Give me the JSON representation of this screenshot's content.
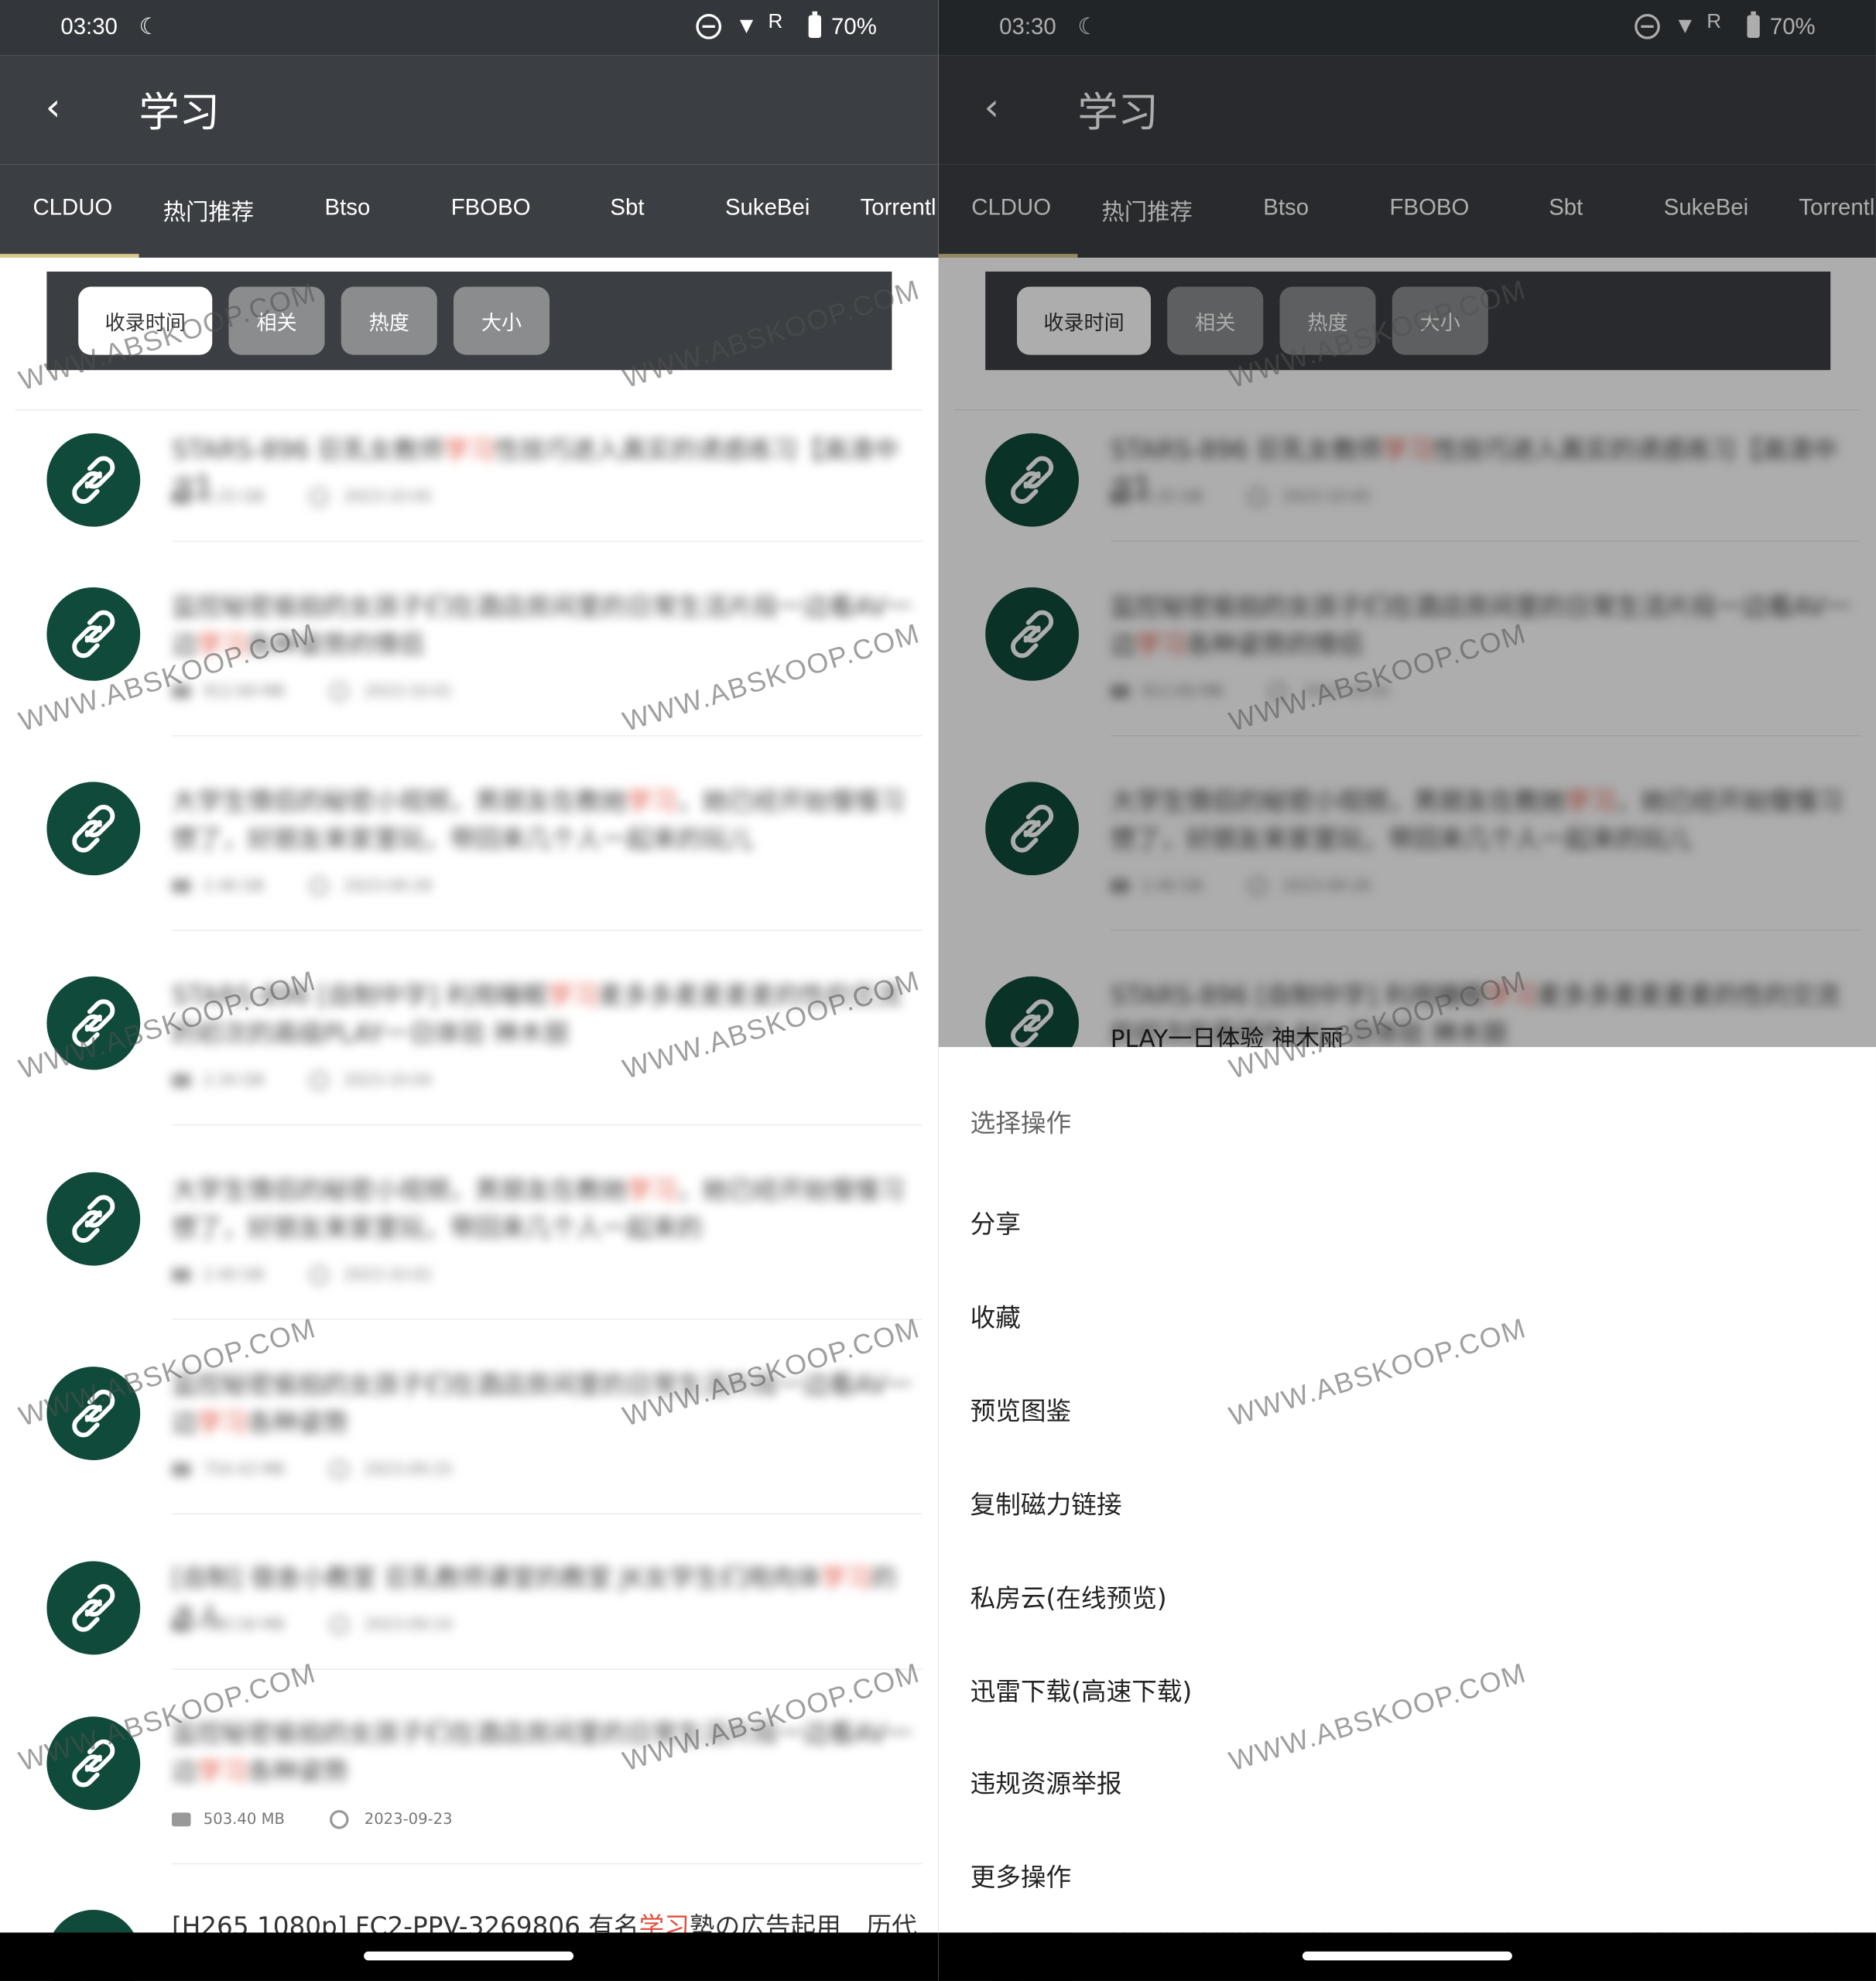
{
  "status": {
    "time": "03:30",
    "moon": "☾",
    "signal_label": "R",
    "battery": "70%"
  },
  "appbar": {
    "back_icon": "‹",
    "title": "学习"
  },
  "tabs": [
    "CLDUO",
    "热门推荐",
    "Btso",
    "FBOBO",
    "Sbt",
    "SukeBei",
    "Torrentl"
  ],
  "sort": {
    "chips": [
      "收录时间",
      "相关",
      "热度",
      "大小"
    ],
    "active_index": 0
  },
  "list": {
    "items": [
      {
        "title_a": "STARS-896 巨乳女教师",
        "kw": "学习",
        "title_b": "性技巧进入真实的诱惑练习【高清中文】",
        "size": "2.25 GB",
        "date": "2023-10-05"
      },
      {
        "title_a": "监控秘密偷拍的女孩子们在酒店房间里的日常生活片段一边看AV一边",
        "kw": "学习",
        "title_b": "各种姿势的情侣",
        "size": "912.69 MB",
        "date": "2023-10-01"
      },
      {
        "title_a": "大学生情侣的秘密小视频，男朋友在教她",
        "kw": "学习",
        "title_b": "，她已经开始慢慢习惯了，好朋友来家里玩，带回来几个人一起来的玩儿",
        "size": "2.46 GB",
        "date": "2023-09-28"
      },
      {
        "title_a": "STARS-896 [自制中字] 利用睡眠",
        "kw": "学习",
        "title_b": "麦多多麦麦麦麦的性的交流的初次的高级PLAY一日体验 神木丽",
        "size": "2.34 GB",
        "date": "2023-10-04"
      },
      {
        "title_a": "大学生情侣的秘密小视频，男朋友在教她",
        "kw": "学习",
        "title_b": "，她已经开始慢慢习惯了，好朋友来家里玩，带回来几个人一起来的",
        "size": "2.40 GB",
        "date": "2023-10-02"
      },
      {
        "title_a": "监控秘密偷拍的女孩子们在酒店房间里的日常生活片段一边看AV一边",
        "kw": "学习",
        "title_b": "各种姿势",
        "size": "754.43 MB",
        "date": "2023-09-25"
      },
      {
        "title_a": "[自制] 宿舍小教室 巨乳教师课堂的教室 JK女学生们用肉体",
        "kw": "学习",
        "title_b": "的大人",
        "size": "583.58 MB",
        "date": "2023-09-24"
      },
      {
        "title_a": "监控秘密偷拍的女孩子们在酒店房间里的日常生活片段一边看AV一边",
        "kw": "学习",
        "title_b": "各种姿势",
        "size": "503.40 MB",
        "date": "2023-09-23",
        "clear_meta": true
      },
      {
        "title_a": "[H265 1080p] FC2-PPV-3269806 有名",
        "kw": "学习",
        "title_b": "塾の広告起用　历代で",
        "size": "",
        "date": "",
        "clear_title": true
      }
    ]
  },
  "sheet": {
    "peek_text": "PLAY一日体验 神木丽",
    "header": "选择操作",
    "items": [
      "分享",
      "收藏",
      "预览图鉴",
      "复制磁力链接",
      "私房云(在线预览)",
      "迅雷下载(高速下载)",
      "违规资源举报",
      "更多操作"
    ]
  },
  "watermark": "WWW.ABSKOOP.COM",
  "colors": {
    "header_bg": "#3b3f43",
    "status_bg": "#33373b",
    "tab_indicator": "#d8c98a",
    "avatar_bg": "#0f4a3a",
    "keyword": "#e0503c"
  }
}
